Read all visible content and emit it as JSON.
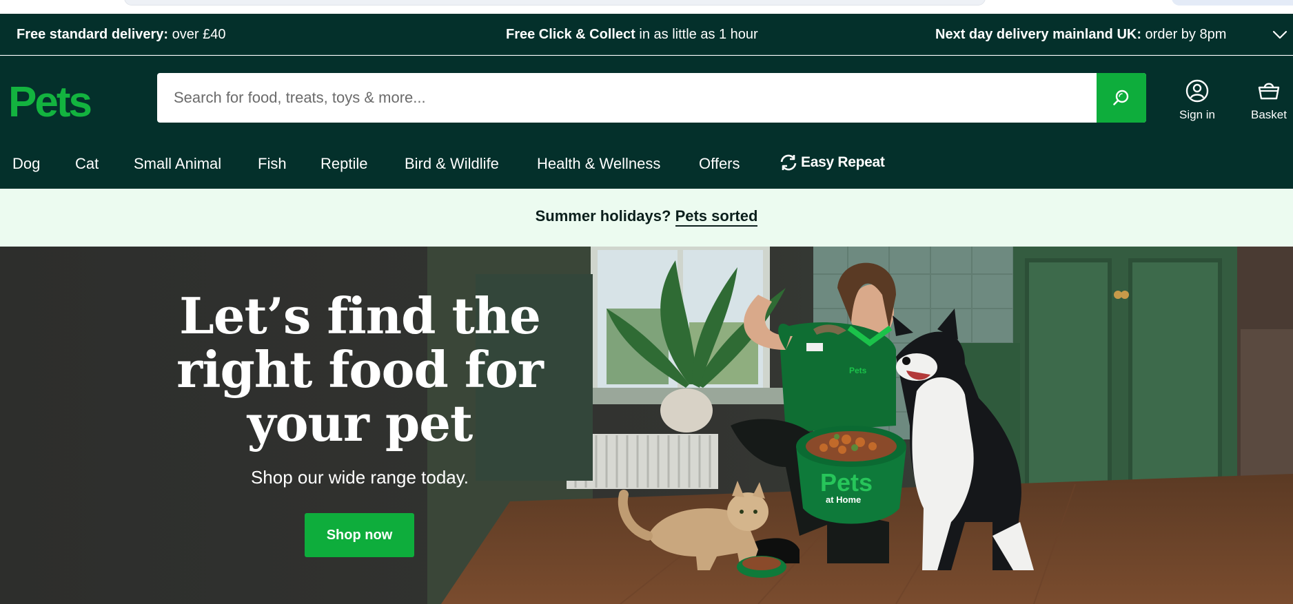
{
  "promo": {
    "m1_bold": "Free standard delivery:",
    "m1_rest": " over £40",
    "m2_bold": "Free Click & Collect",
    "m2_rest": " in as little as 1 hour",
    "m3_bold": "Next day delivery mainland UK:",
    "m3_rest": " order by 8pm"
  },
  "header": {
    "logo_text": "Pets",
    "search_placeholder": "Search for food, treats, toys & more...",
    "sign_in": "Sign in",
    "basket": "Basket"
  },
  "nav": {
    "items": [
      "Dog",
      "Cat",
      "Small Animal",
      "Fish",
      "Reptile",
      "Bird & Wildlife",
      "Health & Wellness",
      "Offers"
    ],
    "easy_repeat": "Easy Repeat"
  },
  "summer": {
    "text": "Summer holidays? ",
    "link": "Pets sorted"
  },
  "hero": {
    "title": "Let’s find the right food for your pet",
    "subtitle": "Shop our wide range today.",
    "cta": "Shop now",
    "bowl_brand": "Pets",
    "bowl_sub": "at Home",
    "shirt_brand": "Pets"
  },
  "colors": {
    "brand_dark": "#04302b",
    "brand_green": "#0ead3c",
    "banner_bg": "#ecfbf0"
  }
}
